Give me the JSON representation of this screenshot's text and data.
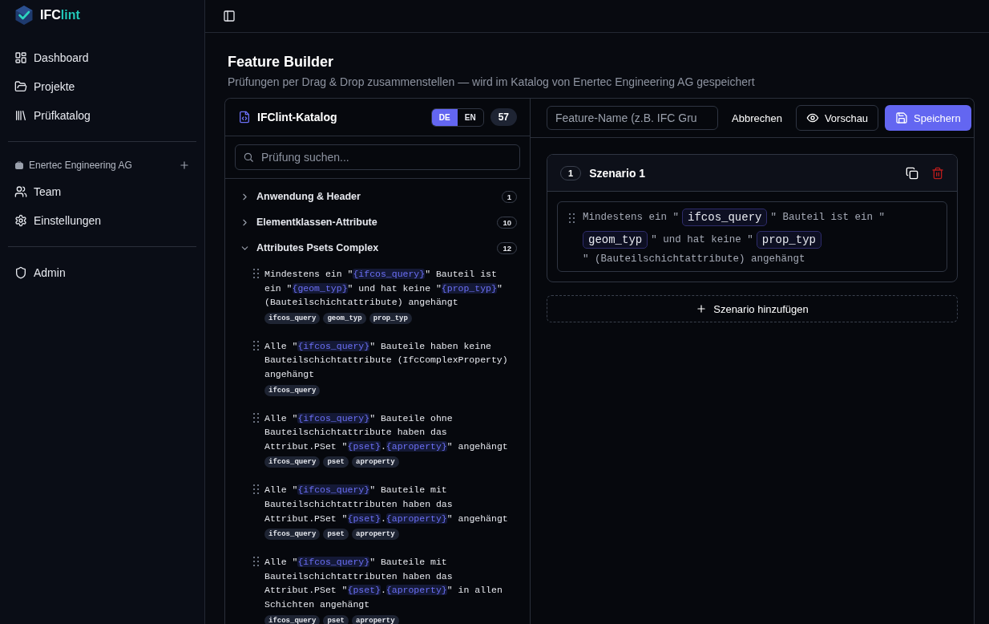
{
  "app": {
    "logo_prefix": "IFC",
    "logo_suffix": "lint"
  },
  "sidebar": {
    "nav": [
      {
        "label": "Dashboard",
        "kind": "dashboard"
      },
      {
        "label": "Projekte",
        "kind": "folder"
      },
      {
        "label": "Prüfkatalog",
        "kind": "library"
      }
    ],
    "organization": {
      "name": "Enertec Engineering AG",
      "items": [
        {
          "label": "Team",
          "kind": "users"
        },
        {
          "label": "Einstellungen",
          "kind": "gear"
        }
      ]
    },
    "admin": [
      {
        "label": "Admin",
        "kind": "shield"
      }
    ]
  },
  "page": {
    "title": "Feature Builder",
    "subtitle": "Prüfungen per Drag & Drop zusammenstellen — wird im Katalog von Enertec Engineering AG gespeichert"
  },
  "catalog": {
    "title": "IFClint-Katalog",
    "languages": [
      {
        "label": "DE",
        "selected": true
      },
      {
        "label": "EN",
        "selected": false
      }
    ],
    "count": "57",
    "search": {
      "placeholder": "Prüfung suchen..."
    },
    "categories": [
      {
        "label": "Anwendung & Header",
        "count": "1",
        "expanded": false
      },
      {
        "label": "Elementklassen-Attribute",
        "count": "10",
        "expanded": false
      },
      {
        "label": "Attributes Psets Complex",
        "count": "12",
        "expanded": true,
        "checks": [
          {
            "parts": [
              {
                "kind": "text",
                "text": "Mindestens ein \""
              },
              {
                "kind": "var",
                "text": "{ifcos_query}"
              },
              {
                "kind": "text",
                "text": "\" Bauteil ist ein \""
              },
              {
                "kind": "var",
                "text": "{geom_typ}"
              },
              {
                "kind": "text",
                "text": "\" und hat keine \""
              },
              {
                "kind": "var",
                "text": "{prop_typ}"
              },
              {
                "kind": "text",
                "text": "\" (Bauteilschichtattribute) angehängt"
              }
            ],
            "tags": [
              "ifcos_query",
              "geom_typ",
              "prop_typ"
            ]
          },
          {
            "parts": [
              {
                "kind": "text",
                "text": "Alle \""
              },
              {
                "kind": "var",
                "text": "{ifcos_query}"
              },
              {
                "kind": "text",
                "text": "\" Bauteile haben keine Bauteilschichtattribute (IfcComplexProperty) angehängt"
              }
            ],
            "tags": [
              "ifcos_query"
            ]
          },
          {
            "parts": [
              {
                "kind": "text",
                "text": "Alle \""
              },
              {
                "kind": "var",
                "text": "{ifcos_query}"
              },
              {
                "kind": "text",
                "text": "\" Bauteile ohne Bauteilschichtattribute haben das Attribut.PSet \""
              },
              {
                "kind": "var",
                "text": "{pset}"
              },
              {
                "kind": "text",
                "text": "."
              },
              {
                "kind": "var",
                "text": "{aproperty}"
              },
              {
                "kind": "text",
                "text": "\" angehängt"
              }
            ],
            "tags": [
              "ifcos_query",
              "pset",
              "aproperty"
            ]
          },
          {
            "parts": [
              {
                "kind": "text",
                "text": "Alle \""
              },
              {
                "kind": "var",
                "text": "{ifcos_query}"
              },
              {
                "kind": "text",
                "text": "\" Bauteile mit Bauteilschichtattributen haben das Attribut.PSet \""
              },
              {
                "kind": "var",
                "text": "{pset}"
              },
              {
                "kind": "text",
                "text": "."
              },
              {
                "kind": "var",
                "text": "{aproperty}"
              },
              {
                "kind": "text",
                "text": "\" angehängt"
              }
            ],
            "tags": [
              "ifcos_query",
              "pset",
              "aproperty"
            ]
          },
          {
            "parts": [
              {
                "kind": "text",
                "text": "Alle \""
              },
              {
                "kind": "var",
                "text": "{ifcos_query}"
              },
              {
                "kind": "text",
                "text": "\" Bauteile mit Bauteilschichtattributen haben das Attribut.PSet \""
              },
              {
                "kind": "var",
                "text": "{pset}"
              },
              {
                "kind": "text",
                "text": "."
              },
              {
                "kind": "var",
                "text": "{aproperty}"
              },
              {
                "kind": "text",
                "text": "\" in allen Schichten angehängt"
              }
            ],
            "tags": [
              "ifcos_query",
              "pset",
              "aproperty"
            ]
          }
        ]
      }
    ]
  },
  "builder": {
    "name_field": {
      "placeholder": "Feature-Name (z.B. IFC Gru"
    },
    "cancel": "Abbrechen",
    "preview": "Vorschau",
    "save": "Speichern",
    "scenarios": [
      {
        "number": "1",
        "title": "Szenario 1",
        "steps": [
          {
            "parts": [
              {
                "kind": "text",
                "text": "Mindestens ein \""
              },
              {
                "kind": "field",
                "text": "ifcos_query"
              },
              {
                "kind": "text",
                "text": "\" Bauteil ist ein \""
              },
              {
                "kind": "field",
                "text": "geom_typ"
              },
              {
                "kind": "text",
                "text": "\" und hat keine \""
              },
              {
                "kind": "field",
                "text": "prop_typ"
              },
              {
                "kind": "text",
                "text": "\" (Bauteilschichtattribute) angehängt"
              }
            ]
          }
        ]
      }
    ],
    "add_scenario": "Szenario hinzufügen"
  }
}
